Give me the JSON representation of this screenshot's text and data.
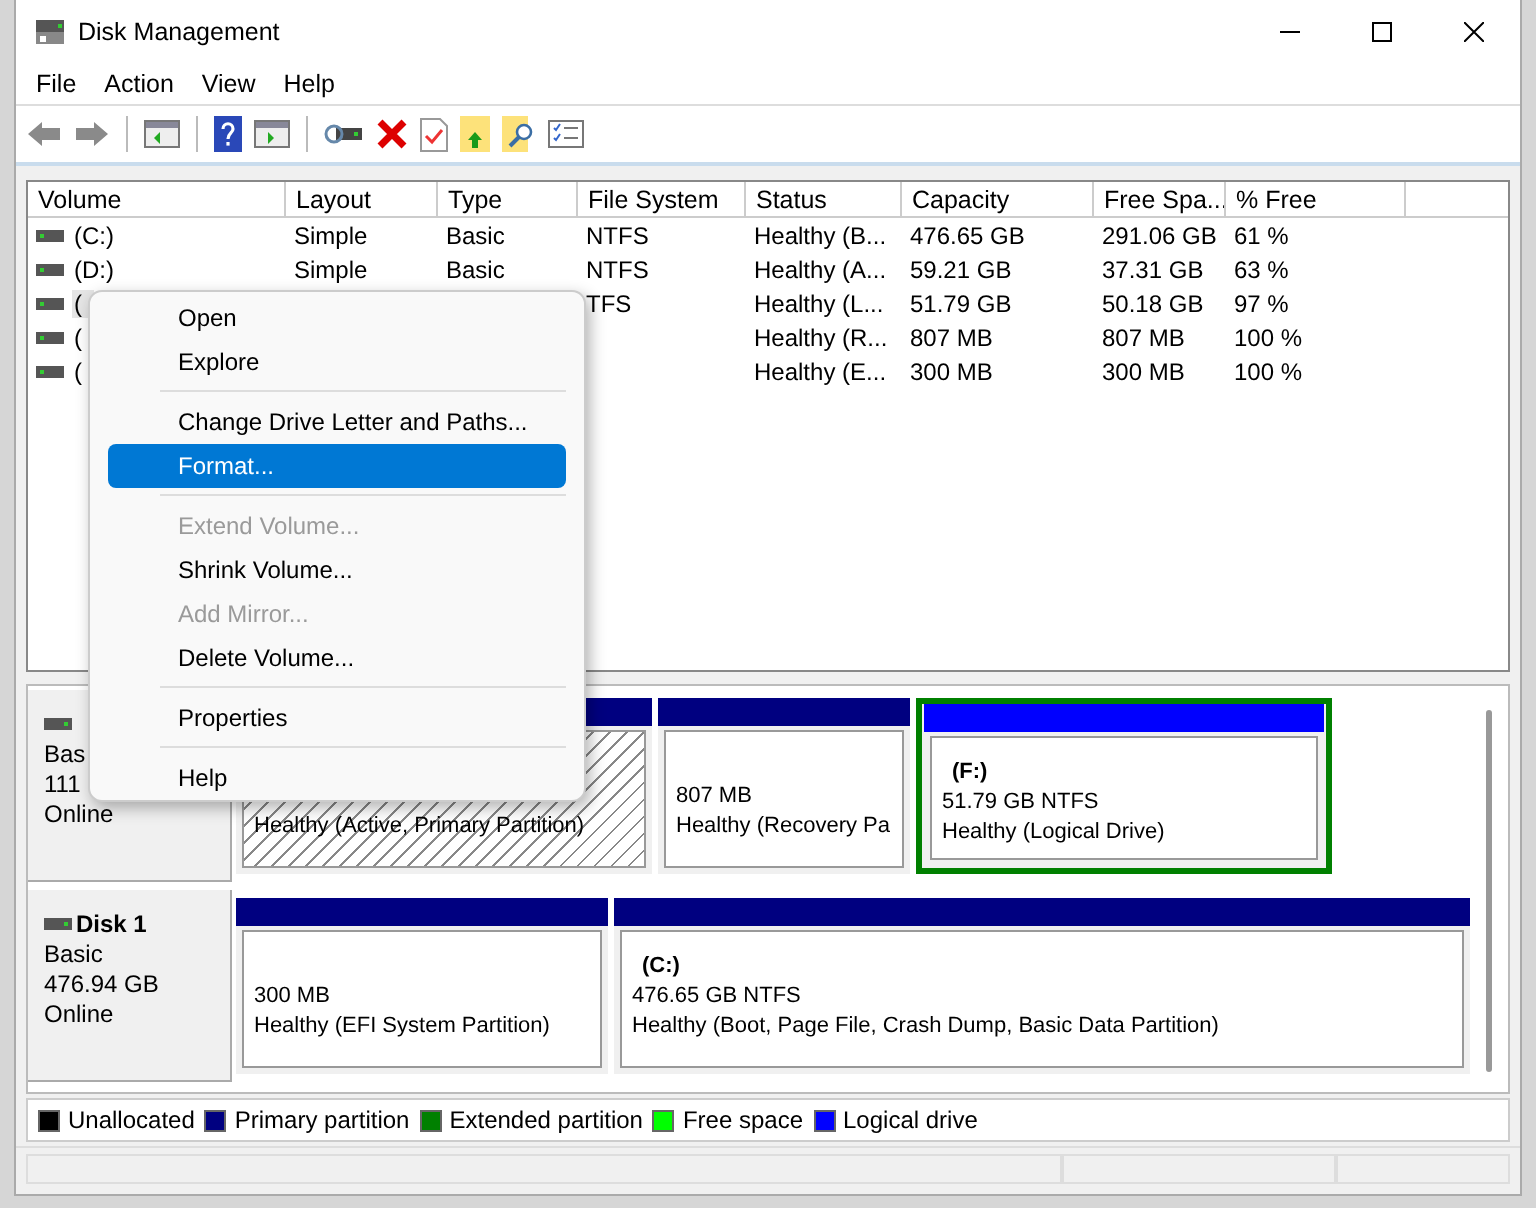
{
  "window": {
    "title": "Disk Management"
  },
  "menu_bar": [
    "File",
    "Action",
    "View",
    "Help"
  ],
  "table": {
    "columns": [
      "Volume",
      "Layout",
      "Type",
      "File System",
      "Status",
      "Capacity",
      "Free Spa...",
      "% Free"
    ],
    "rows": [
      {
        "selected": false,
        "cells": [
          "(C:)",
          "Simple",
          "Basic",
          "NTFS",
          "Healthy (B...",
          "476.65 GB",
          "291.06 GB",
          "61 %"
        ]
      },
      {
        "selected": false,
        "cells": [
          "(D:)",
          "Simple",
          "Basic",
          "NTFS",
          "Healthy (A...",
          "59.21 GB",
          "37.31 GB",
          "63 %"
        ]
      },
      {
        "selected": true,
        "cells": [
          "(",
          "",
          "",
          "TFS",
          "Healthy (L...",
          "51.79 GB",
          "50.18 GB",
          "97 %"
        ]
      },
      {
        "selected": false,
        "cells": [
          "(",
          "",
          "",
          "",
          "Healthy (R...",
          "807 MB",
          "807 MB",
          "100 %"
        ]
      },
      {
        "selected": false,
        "cells": [
          "(",
          "",
          "",
          "",
          "Healthy (E...",
          "300 MB",
          "300 MB",
          "100 %"
        ]
      }
    ]
  },
  "disks": [
    {
      "info": [
        "Bas",
        "111",
        "Online"
      ],
      "partitions": [
        {
          "color": "#000080",
          "selected": true,
          "extended": false,
          "status": "Healthy (Active, Primary Partition)"
        },
        {
          "color": "#000080",
          "selected": false,
          "extended": false,
          "size": "807 MB",
          "status": "Healthy (Recovery Pa"
        },
        {
          "color": "#0000ff",
          "selected": false,
          "extended": true,
          "label": "(F:)",
          "size": "51.79 GB NTFS",
          "status": "Healthy (Logical Drive)"
        }
      ]
    },
    {
      "name": "Disk 1",
      "info": [
        "Basic",
        "476.94 GB",
        "Online"
      ],
      "partitions": [
        {
          "color": "#000080",
          "selected": false,
          "extended": false,
          "size": "300 MB",
          "status": "Healthy (EFI System Partition)"
        },
        {
          "color": "#000080",
          "selected": false,
          "extended": false,
          "label": "(C:)",
          "size": "476.65 GB NTFS",
          "status": "Healthy (Boot, Page File, Crash Dump, Basic Data Partition)"
        }
      ]
    }
  ],
  "legend": [
    {
      "label": "Unallocated",
      "color": "#000000"
    },
    {
      "label": "Primary partition",
      "color": "#000080"
    },
    {
      "label": "Extended partition",
      "color": "#008000"
    },
    {
      "label": "Free space",
      "color": "#00ff00"
    },
    {
      "label": "Logical drive",
      "color": "#0000ff"
    }
  ],
  "context_menu": [
    {
      "kind": "item",
      "label": "Open",
      "selected": false,
      "disabled": false
    },
    {
      "kind": "item",
      "label": "Explore",
      "selected": false,
      "disabled": false
    },
    {
      "kind": "separator"
    },
    {
      "kind": "item",
      "label": "Change Drive Letter and Paths...",
      "selected": false,
      "disabled": false
    },
    {
      "kind": "item",
      "label": "Format...",
      "selected": true,
      "disabled": false
    },
    {
      "kind": "separator"
    },
    {
      "kind": "item",
      "label": "Extend Volume...",
      "selected": false,
      "disabled": true
    },
    {
      "kind": "item",
      "label": "Shrink Volume...",
      "selected": false,
      "disabled": false
    },
    {
      "kind": "item",
      "label": "Add Mirror...",
      "selected": false,
      "disabled": true
    },
    {
      "kind": "item",
      "label": "Delete Volume...",
      "selected": false,
      "disabled": false
    },
    {
      "kind": "separator"
    },
    {
      "kind": "item",
      "label": "Properties",
      "selected": false,
      "disabled": false
    },
    {
      "kind": "separator"
    },
    {
      "kind": "item",
      "label": "Help",
      "selected": false,
      "disabled": false
    }
  ]
}
